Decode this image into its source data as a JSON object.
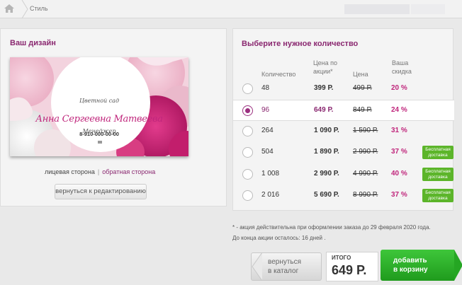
{
  "breadcrumb": {
    "home_icon": "home-icon",
    "current": "Стиль"
  },
  "design": {
    "title": "Ваш дизайн",
    "card": {
      "company": "Цветной сад",
      "name": "Анна Сергеевна Матвеева",
      "position": "Менеджер",
      "phone": "8-910-000-00-00"
    },
    "front_label": "лицевая сторона",
    "separator": "|",
    "back_label": "обратная сторона",
    "edit_button": "вернуться к редактированию"
  },
  "quantity": {
    "title": "Выберите нужное количество",
    "headers": {
      "qty": "Количество",
      "promo_line1": "Цена по",
      "promo_line2": "акции*",
      "price": "Цена",
      "disc_line1": "Ваша",
      "disc_line2": "скидка"
    },
    "rows": [
      {
        "qty": "48",
        "price": "399 Р.",
        "old": "499 Р.",
        "discount": "20 %",
        "selected": false,
        "badge": ""
      },
      {
        "qty": "96",
        "price": "649 Р.",
        "old": "849 Р.",
        "discount": "24 %",
        "selected": true,
        "badge": ""
      },
      {
        "qty": "264",
        "price": "1 090 Р.",
        "old": "1 590 Р.",
        "discount": "31 %",
        "selected": false,
        "badge": ""
      },
      {
        "qty": "504",
        "price": "1 890 Р.",
        "old": "2 990 Р.",
        "discount": "37 %",
        "selected": false,
        "badge": "Бесплатная доставка"
      },
      {
        "qty": "1 008",
        "price": "2 990 Р.",
        "old": "4 990 Р.",
        "discount": "40 %",
        "selected": false,
        "badge": "Бесплатная доставка"
      },
      {
        "qty": "2 016",
        "price": "5 690 Р.",
        "old": "8 990 Р.",
        "discount": "37 %",
        "selected": false,
        "badge": "Бесплатная доставка"
      }
    ]
  },
  "note": {
    "line1": "* - акция действительна при оформлении заказа до 29 февраля 2020 года.",
    "line2": "До конца акции осталось: 16 дней ."
  },
  "actions": {
    "back_line1": "вернуться",
    "back_line2": "в каталог",
    "total_label": "ИТОГО",
    "total_value": "649 Р.",
    "cart_line1": "добавить",
    "cart_line2": "в корзину"
  },
  "colors": {
    "accent": "#8a2870",
    "discount": "#c0267c",
    "badge": "#5cb52a",
    "cart": "#2fb02b"
  }
}
